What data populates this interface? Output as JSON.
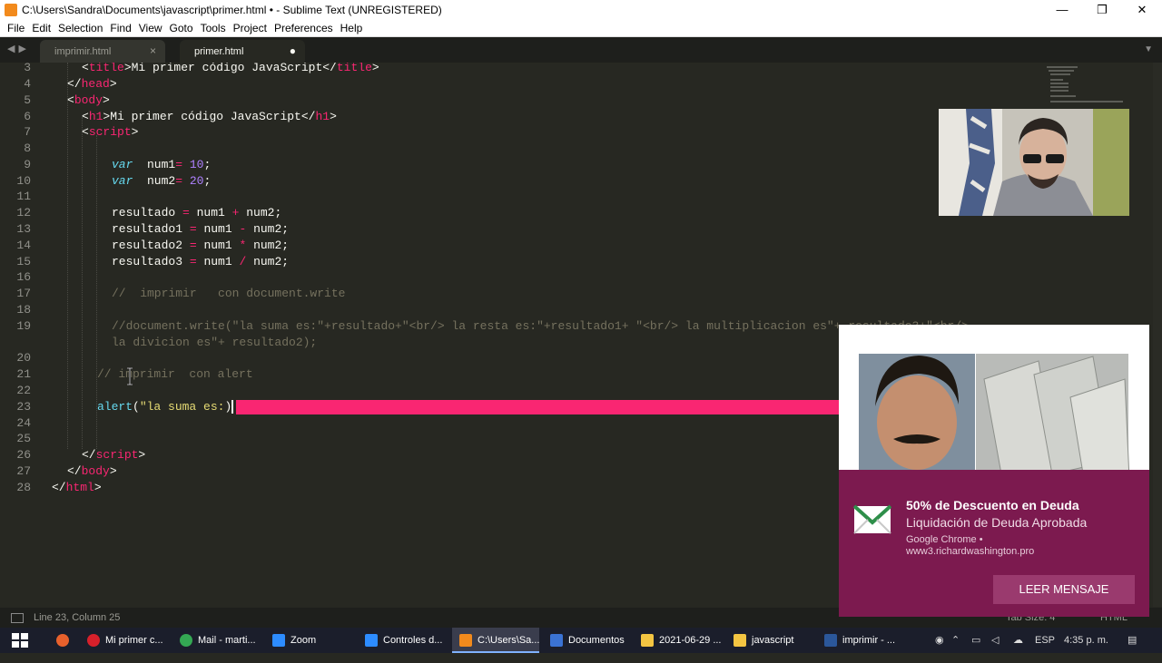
{
  "window": {
    "title": "C:\\Users\\Sandra\\Documents\\javascript\\primer.html • - Sublime Text (UNREGISTERED)",
    "controls": {
      "minimize": "—",
      "maximize": "❐",
      "close": "✕"
    }
  },
  "menu": [
    "File",
    "Edit",
    "Selection",
    "Find",
    "View",
    "Goto",
    "Tools",
    "Project",
    "Preferences",
    "Help"
  ],
  "tabs": [
    {
      "label": "imprimir.html",
      "control": "×"
    },
    {
      "label": "primer.html",
      "control": "●"
    }
  ],
  "tab_nav": {
    "prev": "◀",
    "next": "▶",
    "menu": "▼"
  },
  "line_numbers": [
    "3",
    "4",
    "5",
    "6",
    "7",
    "8",
    "9",
    "10",
    "11",
    "12",
    "13",
    "14",
    "15",
    "16",
    "17",
    "18",
    "19",
    "",
    "20",
    "21",
    "22",
    "23",
    "24",
    "25",
    "26",
    "27",
    "28"
  ],
  "code": {
    "l3": {
      "open_lt": "<",
      "tag": "title",
      "text": ">Mi primer código JavaScript</",
      "tag2": "title",
      "close": ">"
    },
    "l4": {
      "open": "</",
      "tag": "head",
      "close": ">"
    },
    "l5": {
      "open": "<",
      "tag": "body",
      "close": ">"
    },
    "l6": {
      "open": "<",
      "tag": "h1",
      "text": ">Mi primer código JavaScript</",
      "tag2": "h1",
      "close": ">"
    },
    "l7": {
      "open": "<",
      "tag": "script",
      "close": ">"
    },
    "l9": {
      "kw": "var",
      "name": "  num1",
      "op": "=",
      "num": " 10",
      "end": ";"
    },
    "l10": {
      "kw": "var",
      "name": "  num2",
      "op": "=",
      "num": " 20",
      "end": ";"
    },
    "l12": {
      "a": "resultado ",
      "op": "=",
      "b": " num1 ",
      "op2": "+",
      "c": " num2;"
    },
    "l13": {
      "a": "resultado1 ",
      "op": "=",
      "b": " num1 ",
      "op2": "-",
      "c": " num2;"
    },
    "l14": {
      "a": "resultado2 ",
      "op": "=",
      "b": " num1 ",
      "op2": "*",
      "c": " num2;"
    },
    "l15": {
      "a": "resultado3 ",
      "op": "=",
      "b": " num1 ",
      "op2": "/",
      "c": " num2;"
    },
    "l17": "//  imprimir   con document.write",
    "l19a": "//document.write(\"la suma es:\"+resultado+\"<br/> la resta es:\"+resultado1+ \"<br/> la multiplicacion es\"+ resultado3+\"<br/>",
    "l19b": "la divicion es\"+ resultado2);",
    "l21": "// imprimir  con alert",
    "l23": {
      "fn": "alert",
      "paren": "(",
      "str": "\"la suma es:",
      "close": ")"
    },
    "l26": {
      "open": "</",
      "tag": "script",
      "close": ">"
    },
    "l27": {
      "open": "</",
      "tag": "body",
      "close": ">"
    },
    "l28": {
      "open": "</",
      "tag": "html",
      "close": ">"
    }
  },
  "status": {
    "position": "Line 23, Column 25",
    "tab_size": "Tab Size: 4",
    "syntax": "HTML"
  },
  "notification": {
    "title": "50% de Descuento en Deuda",
    "subtitle": "Liquidación de Deuda Aprobada",
    "source": "Google Chrome •",
    "site": "www3.richardwashington.pro",
    "button": "LEER MENSAJE"
  },
  "taskbar": {
    "items": [
      {
        "label": "Mi primer c..."
      },
      {
        "label": "Mail - marti..."
      },
      {
        "label": "Zoom"
      },
      {
        "label": "Controles d..."
      },
      {
        "label": "C:\\Users\\Sa..."
      },
      {
        "label": "Documentos"
      },
      {
        "label": "2021-06-29 ..."
      },
      {
        "label": "javascript"
      },
      {
        "label": "imprimir - ..."
      }
    ],
    "tray": {
      "lang": "ESP",
      "time": "4:35 p. m."
    }
  },
  "colors": {
    "editor_bg": "#272822",
    "tag": "#f92672",
    "keyword": "#66d9ef",
    "number": "#ae81ff",
    "comment": "#75715e",
    "notification_bg": "#7c1a4f",
    "selection_highlight": "#f92672"
  }
}
